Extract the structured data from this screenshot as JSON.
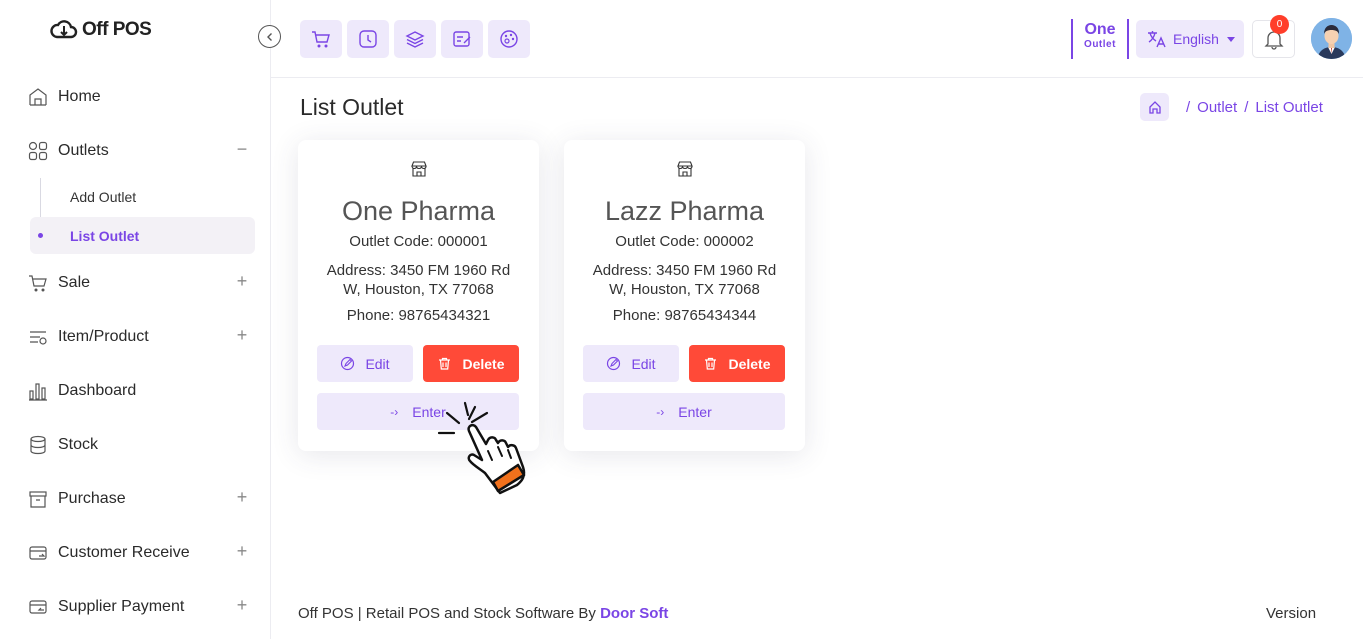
{
  "app": {
    "logo_text": "Off POS"
  },
  "sidebar": {
    "items": [
      {
        "label": "Home",
        "icon": "home-icon"
      },
      {
        "label": "Outlets",
        "icon": "grid-icon",
        "toggle": "−"
      },
      {
        "label": "Sale",
        "icon": "cart-icon",
        "toggle": "+"
      },
      {
        "label": "Item/Product",
        "icon": "list-icon",
        "toggle": "+"
      },
      {
        "label": "Dashboard",
        "icon": "bar-chart-icon"
      },
      {
        "label": "Stock",
        "icon": "database-icon"
      },
      {
        "label": "Purchase",
        "icon": "archive-icon",
        "toggle": "+"
      },
      {
        "label": "Customer Receive",
        "icon": "receive-icon",
        "toggle": "+"
      },
      {
        "label": "Supplier Payment",
        "icon": "payment-icon",
        "toggle": "+"
      }
    ],
    "outlet_sub": [
      {
        "label": "Add Outlet"
      },
      {
        "label": "List Outlet",
        "active": true
      }
    ]
  },
  "topbar": {
    "quick_icons": [
      "cart-icon",
      "clock-icon",
      "layers-icon",
      "edit-note-icon",
      "palette-icon"
    ],
    "outlet": {
      "name": "One",
      "sub": "Outlet"
    },
    "language": "English",
    "notification_count": "0"
  },
  "page": {
    "title": "List Outlet",
    "breadcrumb": [
      "Outlet",
      "List Outlet"
    ]
  },
  "outlets": [
    {
      "name": "One Pharma",
      "code": "Outlet Code: 000001",
      "address": "Address: 3450 FM 1960 Rd W, Houston, TX 77068",
      "phone": "Phone: 98765434321",
      "edit": "Edit",
      "delete": "Delete",
      "enter": "Enter"
    },
    {
      "name": "Lazz Pharma",
      "code": "Outlet Code: 000002",
      "address": "Address: 3450 FM 1960 Rd W, Houston, TX 77068",
      "phone": "Phone: 98765434344",
      "edit": "Edit",
      "delete": "Delete",
      "enter": "Enter"
    }
  ],
  "footer": {
    "text": "Off POS | Retail POS and Stock Software By ",
    "brand": "Door Soft",
    "version": "Version"
  },
  "colors": {
    "accent": "#7a45e5",
    "danger": "#ff4a38",
    "soft": "#eee9fb"
  }
}
